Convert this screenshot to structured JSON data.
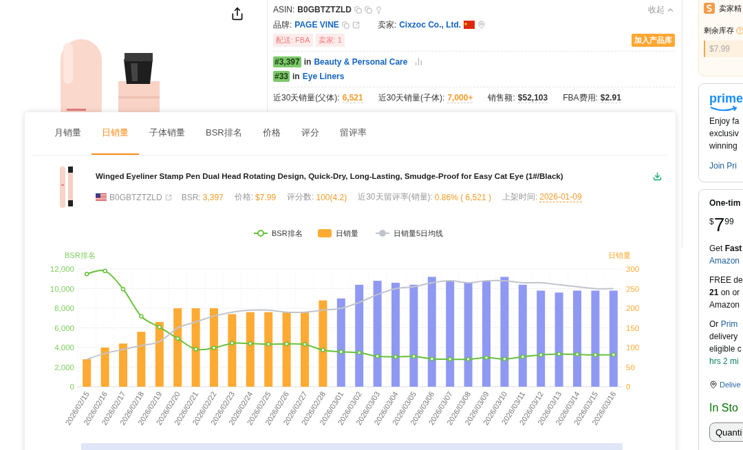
{
  "info": {
    "asin_label": "ASIN:",
    "asin": "B0GBTZTZLD",
    "collapse": "收起",
    "brand_label": "品牌:",
    "brand": "PAGE VINE",
    "seller_label": "卖家:",
    "seller": "Cixzoc Co., Ltd.",
    "tags": [
      "配送: FBA",
      "卖家: 1"
    ],
    "add_button": "加入产品库",
    "ranks": [
      {
        "rank": "#3,397",
        "in": "in",
        "category": "Beauty & Personal Care",
        "chart_icon": true
      },
      {
        "rank": "#33",
        "in": "in",
        "category": "Eye Liners",
        "chart_icon": false
      }
    ],
    "stats": [
      {
        "label": "近30天销量(父体):",
        "value": "6,521",
        "kind": "highlight"
      },
      {
        "label": "近30天销量(子体):",
        "value": "7,000+",
        "kind": "highlight"
      },
      {
        "label": "销售额:",
        "value": "$52,103",
        "kind": "plain"
      },
      {
        "label": "FBA费用:",
        "value": "$2.91",
        "kind": "plain"
      }
    ]
  },
  "sidebar": {
    "plugin": {
      "title": "卖家精",
      "stock_label": "剩余库存",
      "stock_value": "$7.99"
    },
    "prime": {
      "logo": "prime",
      "lines": [
        "Enjoy fa",
        "exclusiv",
        "winning"
      ],
      "link": "Join Pri"
    },
    "offer": {
      "title": "One-tim",
      "price": {
        "currency": "$",
        "whole": "7",
        "fraction": "99"
      },
      "groups": [
        [
          {
            "kind": "plain",
            "text": "Get **Fast**"
          },
          {
            "kind": "link",
            "text": "Amazon"
          }
        ],
        [
          {
            "kind": "plain",
            "text": "FREE de"
          },
          {
            "kind": "plain",
            "text": "**21** on or"
          },
          {
            "kind": "plain",
            "text": "Amazon"
          }
        ],
        [
          {
            "kind": "mixed",
            "text": "Or",
            "link": "Prim"
          },
          {
            "kind": "plain",
            "text": "delivery"
          },
          {
            "kind": "plain",
            "text": "eligible c"
          },
          {
            "kind": "timer",
            "text": "hrs 2 mi"
          }
        ]
      ],
      "deliver": "Delive",
      "stock": "In Sto",
      "quantity": "Quanti"
    }
  },
  "modal": {
    "tabs": [
      {
        "label": "月销量",
        "selected": false
      },
      {
        "label": "日销量",
        "selected": true
      },
      {
        "label": "子体销量",
        "selected": false
      },
      {
        "label": "BSR排名",
        "selected": false
      },
      {
        "label": "价格",
        "selected": false
      },
      {
        "label": "评分",
        "selected": false
      },
      {
        "label": "留评率",
        "selected": false
      }
    ],
    "product": {
      "title": "Winged Eyeliner Stamp Pen Dual Head Rotating Design, Quick-Dry, Long-Lasting, Smudge-Proof for Easy Cat Eye (1#/Black)",
      "asin": "B0GBTZTZLD",
      "metrics": [
        {
          "label": "BSR:",
          "value": "3,397",
          "kind": "plain"
        },
        {
          "label": "价格:",
          "value": "$7.99",
          "kind": "plain"
        },
        {
          "label": "评分数:",
          "value": "100(4.2)",
          "kind": "plain"
        },
        {
          "label": "近30天留评率(销量):",
          "value": "0.86% ( 6,521 )",
          "kind": "plain"
        },
        {
          "label": "上架时间:",
          "value": "2026-01-09",
          "kind": "date"
        }
      ]
    },
    "chart_data": {
      "type": "bar",
      "grid": true,
      "legend": true,
      "ylabel": "BSR排名",
      "y2label": "日销量",
      "ylim": [
        0,
        12000
      ],
      "y2lim": [
        0,
        300
      ],
      "yticks": [
        {
          "value": 0,
          "label": "0"
        },
        {
          "value": 2000,
          "label": "2,000"
        },
        {
          "value": 4000,
          "label": "4,000"
        },
        {
          "value": 6000,
          "label": "6,000"
        },
        {
          "value": 8000,
          "label": "8,000"
        },
        {
          "value": 10000,
          "label": "10,000"
        },
        {
          "value": 12000,
          "label": "12,000"
        }
      ],
      "y2ticks": [
        0,
        50,
        100,
        150,
        200,
        250,
        300
      ],
      "categories": [
        "2026/02/15",
        "2026/02/16",
        "2026/02/17",
        "2026/02/18",
        "2026/02/19",
        "2026/02/20",
        "2026/02/21",
        "2026/02/22",
        "2026/02/23",
        "2026/02/24",
        "2026/02/25",
        "2026/02/26",
        "2026/02/27",
        "2026/02/28",
        "2026/03/01",
        "2026/03/02",
        "2026/03/03",
        "2026/03/04",
        "2026/03/05",
        "2026/03/06",
        "2026/03/07",
        "2026/03/08",
        "2026/03/09",
        "2026/03/10",
        "2026/03/11",
        "2026/03/12",
        "2026/03/13",
        "2026/03/14",
        "2026/03/15",
        "2026/03/16"
      ],
      "series": [
        {
          "name": "BSR排名",
          "type": "line",
          "marker": "circle",
          "color": "#67c23a",
          "values": [
            11500,
            11800,
            9950,
            7180,
            6080,
            4920,
            3820,
            3960,
            4430,
            4400,
            4330,
            4360,
            4310,
            3730,
            3560,
            3470,
            3100,
            3050,
            3080,
            2840,
            2800,
            2800,
            2960,
            2820,
            3050,
            3240,
            3330,
            3290,
            3240,
            3260
          ]
        },
        {
          "name": "日销量",
          "type": "bar",
          "axis": "y2",
          "color": "#ffaa33",
          "values": [
            70,
            100,
            110,
            140,
            165,
            200,
            200,
            200,
            185,
            190,
            190,
            190,
            190,
            220,
            null,
            null,
            null,
            null,
            null,
            null,
            null,
            null,
            null,
            null,
            null,
            null,
            null,
            null,
            null,
            null
          ]
        },
        {
          "type": "bar",
          "axis": "y2",
          "color": "#8f99f3",
          "values": [
            null,
            null,
            null,
            null,
            null,
            null,
            null,
            null,
            null,
            null,
            null,
            null,
            null,
            null,
            225,
            260,
            270,
            265,
            260,
            280,
            270,
            265,
            270,
            280,
            260,
            245,
            240,
            245,
            245,
            245
          ]
        },
        {
          "name": "日销量5日均线",
          "type": "line",
          "axis": "y2",
          "color": "#c0c4cc",
          "values": [
            70,
            85,
            95,
            105,
            115,
            150,
            165,
            180,
            190,
            195,
            195,
            190,
            190,
            195,
            200,
            215,
            235,
            250,
            255,
            265,
            270,
            265,
            270,
            270,
            265,
            265,
            260,
            255,
            250,
            250
          ]
        }
      ]
    }
  }
}
